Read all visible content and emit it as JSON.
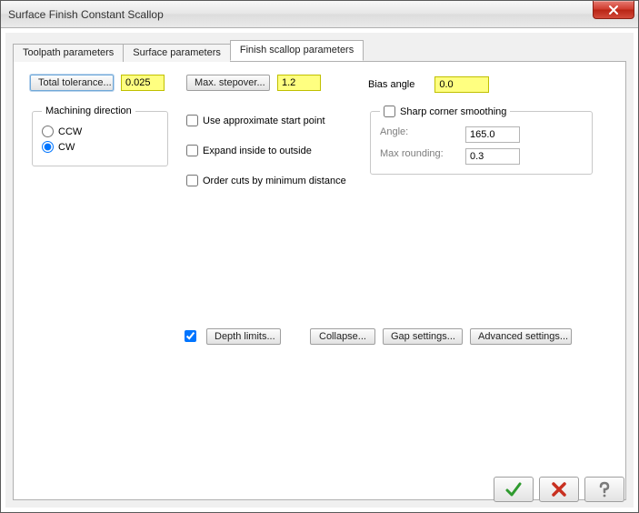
{
  "window": {
    "title": "Surface Finish Constant Scallop"
  },
  "tabs": [
    "Toolpath parameters",
    "Surface parameters",
    "Finish scallop parameters"
  ],
  "active_tab": 2,
  "totalTolerance": {
    "button": "Total tolerance...",
    "value": "0.025"
  },
  "maxStepover": {
    "button": "Max. stepover...",
    "value": "1.2"
  },
  "biasAngle": {
    "label": "Bias angle",
    "value": "0.0"
  },
  "machiningDirection": {
    "legend": "Machining direction",
    "options": [
      "CCW",
      "CW"
    ],
    "selected": "CW"
  },
  "options": {
    "approxStart": {
      "label": "Use approximate start point",
      "checked": false
    },
    "expandInside": {
      "label": "Expand inside to outside",
      "checked": false
    },
    "orderCuts": {
      "label": "Order cuts by minimum distance",
      "checked": false
    }
  },
  "sharpCorner": {
    "enabled": false,
    "label": "Sharp corner smoothing",
    "angleLabel": "Angle:",
    "angle": "165.0",
    "maxRoundLabel": "Max rounding:",
    "maxRounding": "0.3"
  },
  "bottomRow": {
    "depthLimitsChecked": true,
    "depthLimits": "Depth limits...",
    "collapse": "Collapse...",
    "gapSettings": "Gap settings...",
    "advanced": "Advanced settings..."
  },
  "dialogButtons": {
    "ok": "ok-icon",
    "cancel": "cancel-icon",
    "help": "help-icon"
  }
}
